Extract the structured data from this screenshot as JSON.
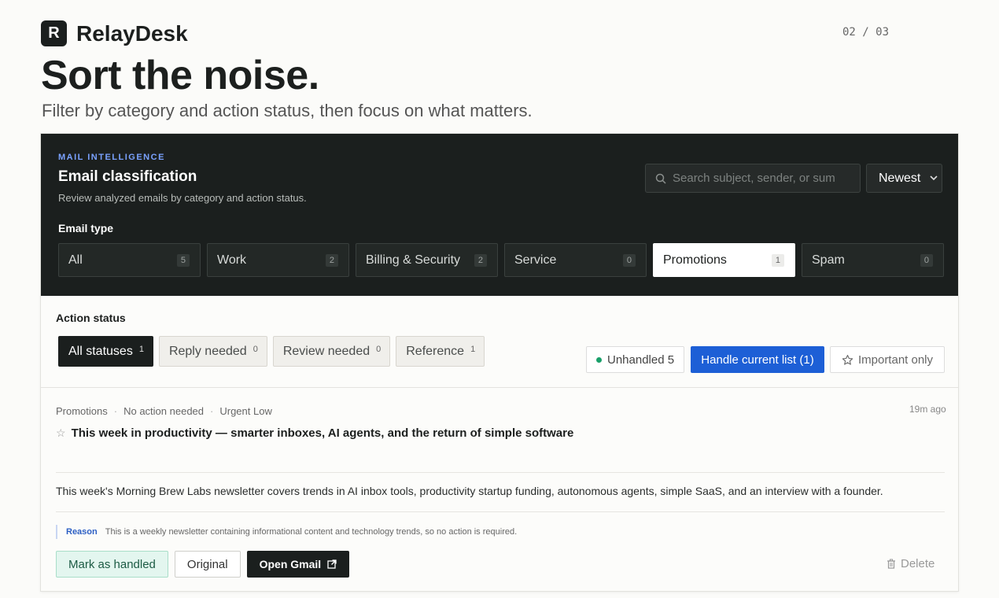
{
  "brand": {
    "logo_letter": "R",
    "name": "RelayDesk"
  },
  "page_counter": "02 / 03",
  "hero": {
    "headline": "Sort the noise.",
    "subhead": "Filter by category and action status, then focus on what matters."
  },
  "panel": {
    "eyebrow": "MAIL INTELLIGENCE",
    "title": "Email classification",
    "description": "Review analyzed emails by category and action status.",
    "search": {
      "placeholder": "Search subject, sender, or sum",
      "value": ""
    },
    "sort": {
      "selected": "Newest"
    },
    "email_type_label": "Email type",
    "email_types": [
      {
        "label": "All",
        "count": "5"
      },
      {
        "label": "Work",
        "count": "2"
      },
      {
        "label": "Billing & Security",
        "count": "2"
      },
      {
        "label": "Service",
        "count": "0"
      },
      {
        "label": "Promotions",
        "count": "1",
        "active": true
      },
      {
        "label": "Spam",
        "count": "0"
      }
    ]
  },
  "action_status": {
    "label": "Action status",
    "statuses": [
      {
        "label": "All statuses",
        "count": "1",
        "active": true
      },
      {
        "label": "Reply needed",
        "count": "0"
      },
      {
        "label": "Review needed",
        "count": "0"
      },
      {
        "label": "Reference",
        "count": "1"
      }
    ],
    "unhandled": "Unhandled 5",
    "handle_button": "Handle current list (1)",
    "important_only": "Important only"
  },
  "email": {
    "category": "Promotions",
    "action": "No action needed",
    "urgency": "Urgent Low",
    "age": "19m ago",
    "subject": "This week in productivity — smarter inboxes, AI agents, and the return of simple software",
    "summary": "This week's Morning Brew Labs newsletter covers trends in AI inbox tools, productivity startup funding, autonomous agents, simple SaaS, and an interview with a founder.",
    "reason_label": "Reason",
    "reason": "This is a weekly newsletter containing informational content and technology trends, so no action is required.",
    "buttons": {
      "mark_handled": "Mark as handled",
      "original": "Original",
      "open_gmail": "Open Gmail",
      "delete": "Delete"
    }
  },
  "colors": {
    "dark_panel": "#1b1f1e",
    "accent_blue": "#1d5fd6",
    "eyebrow": "#7aa2ff",
    "status_green": "#1aa06a"
  }
}
